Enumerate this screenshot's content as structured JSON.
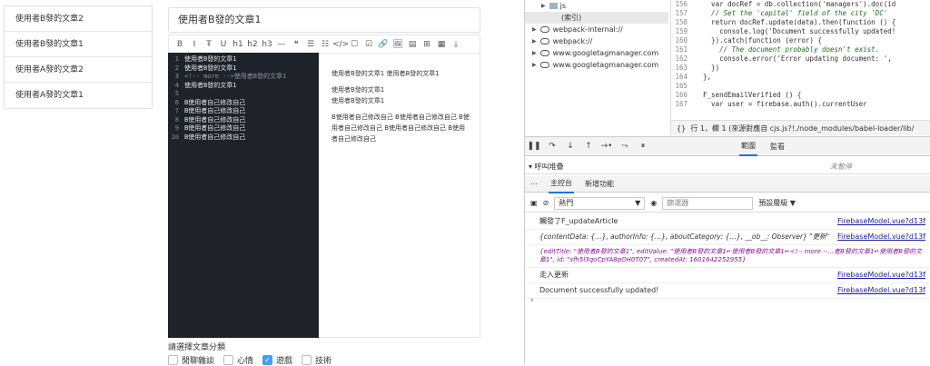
{
  "article_list": [
    "使用者B發的文章2",
    "使用者B發的文章1",
    "使用者A發的文章2",
    "使用者A發的文章1"
  ],
  "editor": {
    "title_value": "使用者B發的文章1",
    "toolbar": [
      "B",
      "I",
      "Ŧ",
      "U",
      "h1",
      "h2",
      "h3",
      "—",
      "❝",
      "☰",
      "☷",
      "</>",
      "☐",
      "☑",
      "🔗",
      "🖼",
      "▤",
      "⊞",
      "▦",
      "⤓"
    ],
    "lines": [
      {
        "n": "1",
        "t": "使用者B發的文章1"
      },
      {
        "n": "2",
        "t": "使用者B發的文章1"
      },
      {
        "n": "3",
        "t": "<!-- more -->使用者B發的文章1"
      },
      {
        "n": "4",
        "t": "使用者B發的文章1"
      },
      {
        "n": "5",
        "t": ""
      },
      {
        "n": "6",
        "t": "B使用者自己修改自己"
      },
      {
        "n": "7",
        "t": "B使用者自己修改自己"
      },
      {
        "n": "8",
        "t": "B使用者自己修改自己"
      },
      {
        "n": "9",
        "t": "B使用者自己修改自己"
      },
      {
        "n": "10",
        "t": "B使用者自己修改自己"
      }
    ],
    "preview": [
      "使用者B發的文章1 使用者B發的文章1",
      "使用者B發的文章1",
      "使用者B發的文章1",
      "B使用者自己修改自己 B使用者自己修改自己 B使用者自己修改自己 B使用者自己修改自己 B使用者自己修改自己"
    ]
  },
  "category": {
    "label": "請選擇文章分類",
    "options": [
      {
        "label": "閒聊雜談",
        "checked": false
      },
      {
        "label": "心情",
        "checked": false
      },
      {
        "label": "遊戲",
        "checked": true
      },
      {
        "label": "技術",
        "checked": false
      }
    ]
  },
  "devtools": {
    "tree": [
      {
        "type": "folder",
        "label": "js"
      },
      {
        "type": "file",
        "label": "(索引)"
      },
      {
        "type": "cloud",
        "label": "webpack-internal://"
      },
      {
        "type": "cloud",
        "label": "webpack://"
      },
      {
        "type": "cloud",
        "label": "www.googletagmanager.com"
      },
      {
        "type": "cloud",
        "label": "www.googletagmanager.com"
      }
    ],
    "code": [
      {
        "n": "156",
        "t": "    var docRef = db.collection('managers').doc(id"
      },
      {
        "n": "157",
        "t": "    // Set the 'capital' field of the city 'DC'",
        "c": "cmt"
      },
      {
        "n": "158",
        "t": "    return docRef.update(data).then(function () {"
      },
      {
        "n": "159",
        "t": "      console.log('Document successfully updated!"
      },
      {
        "n": "160",
        "t": "    }).catch(function (error) {"
      },
      {
        "n": "161",
        "t": "      // The document probably doesn't exist.",
        "c": "cmt"
      },
      {
        "n": "162",
        "t": "      console.error('Error updating document: ',"
      },
      {
        "n": "163",
        "t": "    })"
      },
      {
        "n": "164",
        "t": "  },"
      },
      {
        "n": "165",
        "t": ""
      },
      {
        "n": "166",
        "t": "  F_sendEmailVerified () {"
      },
      {
        "n": "167",
        "t": "    var user = firebase.auth().currentUser"
      }
    ],
    "status": "行 1，欄 1 (來源對應自 cjs.js?!./node_modules/babel-loader/lib/",
    "scope_tabs": [
      "範圍",
      "監看"
    ],
    "callstack": "▾ 呼叫堆疊",
    "paused": "未暫停",
    "drawer_tabs": [
      "主控台",
      "新增功能"
    ],
    "context": "熱門",
    "filter_placeholder": "篩選器",
    "levels": "預設層級 ▼",
    "console": [
      {
        "msg": "觸發了F_updateArticle",
        "src": "FirebaseModel.vue?d13f"
      },
      {
        "msg": "{contentData: {…}, authorInfo: {…}, aboutCategory: {…}, __ob__: Observer} \"更新\"",
        "src": "FirebaseModel.vue?d13f"
      },
      {
        "msg": "{editTitle: \"使用者B發的文章1\", editValue: \"使用者B發的文章1↵使用者B發的文章1↵<!-- more --…者B發的文章1↵使用者B發的文章1\", id: \"sfh5l3qoCpYA8pOH0T07\", createdAt: 1601642252955}",
        "src": ""
      },
      {
        "msg": "走入更新",
        "src": "FirebaseModel.vue?d13f"
      },
      {
        "msg": "Document successfully updated!",
        "src": "FirebaseModel.vue?d13f"
      }
    ],
    "prompt": "›"
  }
}
